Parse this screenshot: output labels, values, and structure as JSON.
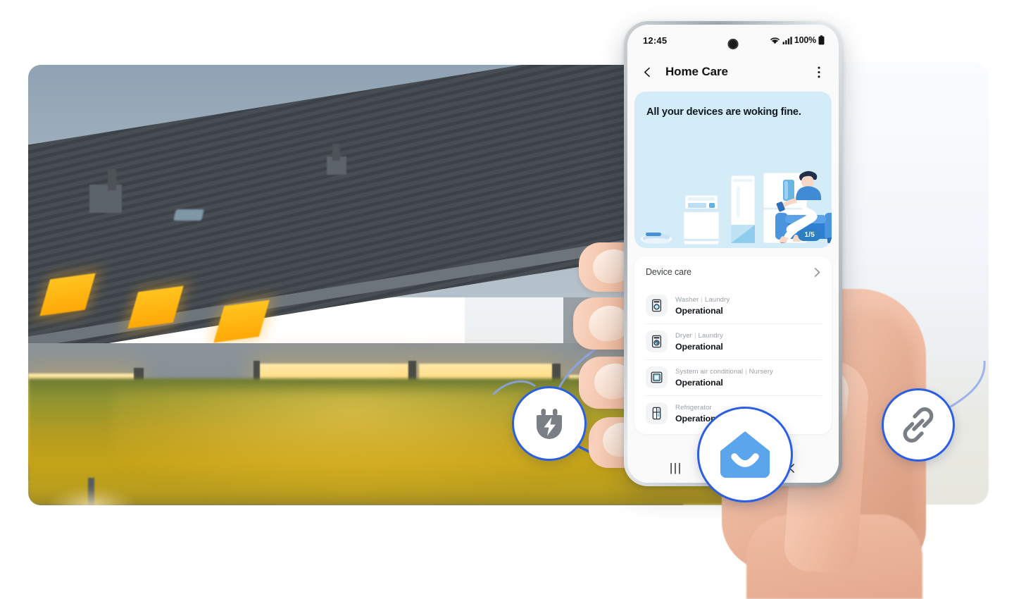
{
  "scene": {
    "description": "Samsung SmartThings Home Care promo — hand holding phone over a dusk smart-home photo",
    "accent_blue": "#2b5fe3",
    "logo_blue": "#5aa5ec",
    "hero_bg": "#d3ecf7",
    "badge_gray": "#7a7f85"
  },
  "phone": {
    "statusbar": {
      "time": "12:45",
      "battery_text": "100%",
      "icons": [
        "wifi-icon",
        "cellular-signal-icon",
        "battery-icon"
      ]
    },
    "appbar": {
      "back_icon": "chevron-left-icon",
      "title": "Home Care",
      "overflow_icon": "more-vertical-icon"
    },
    "hero": {
      "title": "All your devices are woking fine.",
      "pagination": "1/5",
      "illustration": "smart-home-appliances-illustration"
    },
    "device_care": {
      "header_label": "Device care",
      "header_chevron": "chevron-right-icon",
      "rows": [
        {
          "icon": "washer-icon",
          "device": "Washer",
          "room": "Laundry",
          "status": "Operational"
        },
        {
          "icon": "dryer-icon",
          "device": "Dryer",
          "room": "Laundry",
          "status": "Operational"
        },
        {
          "icon": "ac-icon",
          "device": "System air conditional",
          "room": "Nursery",
          "status": "Operational"
        },
        {
          "icon": "fridge-icon",
          "device": "Refrigerator",
          "room": "",
          "status": "Operational"
        }
      ],
      "separator": "|"
    },
    "navbar": {
      "recents_label": "|||",
      "recents_icon": "recents-icon",
      "home_icon": "home-icon",
      "back_icon": "nav-back-icon"
    }
  },
  "badges": [
    {
      "name": "power-badge",
      "icon": "power-plug-bolt-icon"
    },
    {
      "name": "smartthings-logo-badge",
      "icon": "smartthings-home-smile-icon"
    },
    {
      "name": "link-badge",
      "icon": "chain-link-icon"
    }
  ]
}
